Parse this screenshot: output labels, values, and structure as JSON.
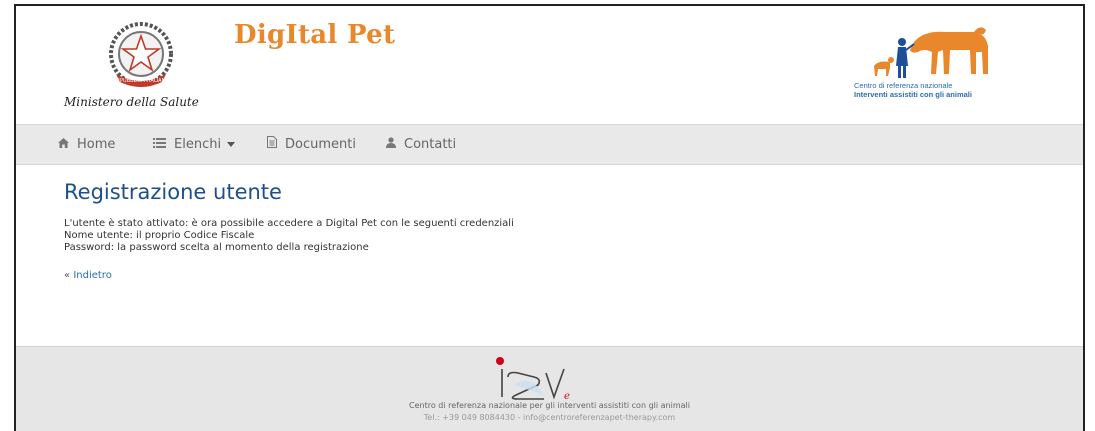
{
  "header": {
    "ministry_caption": "Ministero della Salute",
    "emblem_ribbon": "REPUBBLICA ITALIANA",
    "app_title": "DigItal Pet",
    "partner_line1": "Centro di referenza nazionale",
    "partner_line2": "Interventi assistiti con gli animali"
  },
  "nav": {
    "items": [
      {
        "label": "Home",
        "icon": "home-icon"
      },
      {
        "label": "Elenchi",
        "icon": "list-icon"
      },
      {
        "label": "Documenti",
        "icon": "document-icon"
      },
      {
        "label": "Contatti",
        "icon": "user-icon"
      }
    ]
  },
  "main": {
    "title": "Registrazione utente",
    "lines": [
      "L'utente è stato attivato: è ora possibile accedere a Digital Pet con le seguenti credenziali",
      "Nome utente: il proprio Codice Fiscale",
      "Password: la password scelta al momento della registrazione"
    ],
    "back_prefix": "«",
    "back_label": "Indietro"
  },
  "footer": {
    "line1": "Centro di referenza nazionale per gli interventi assistiti con gli animali",
    "line2": "Tel.: +39 049 8084430 - info@centroreferenzapet-therapy.com"
  },
  "colors": {
    "title_orange": "#e8872b",
    "heading_blue": "#1d4f8c",
    "link_blue": "#2a6db5",
    "nav_bg": "#e9e9e9",
    "footer_bg": "#e6e6e6"
  }
}
